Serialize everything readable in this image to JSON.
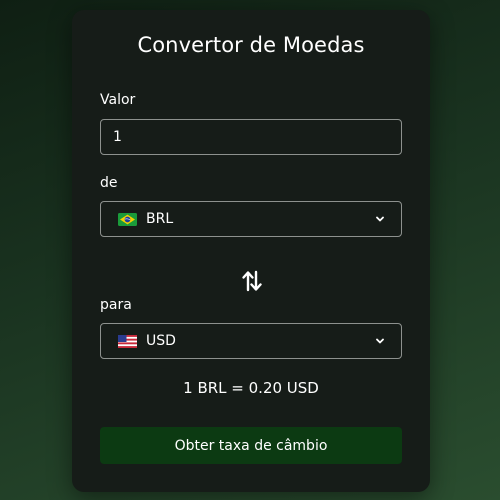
{
  "title": "Convertor de Moedas",
  "amount": {
    "label": "Valor",
    "value": "1"
  },
  "from": {
    "label": "de",
    "flag_icon": "brazil-flag-icon",
    "currency": "BRL"
  },
  "swap_icon": "swap-arrows-icon",
  "to": {
    "label": "para",
    "flag_icon": "usa-flag-icon",
    "currency": "USD"
  },
  "rate_text": "1 BRL = 0.20 USD",
  "button": {
    "label": "Obter taxa de câmbio"
  },
  "colors": {
    "background": "#1a3320",
    "card": "#161c18",
    "button": "#0c3a12",
    "border": "#8d918e",
    "text": "#ffffff"
  }
}
